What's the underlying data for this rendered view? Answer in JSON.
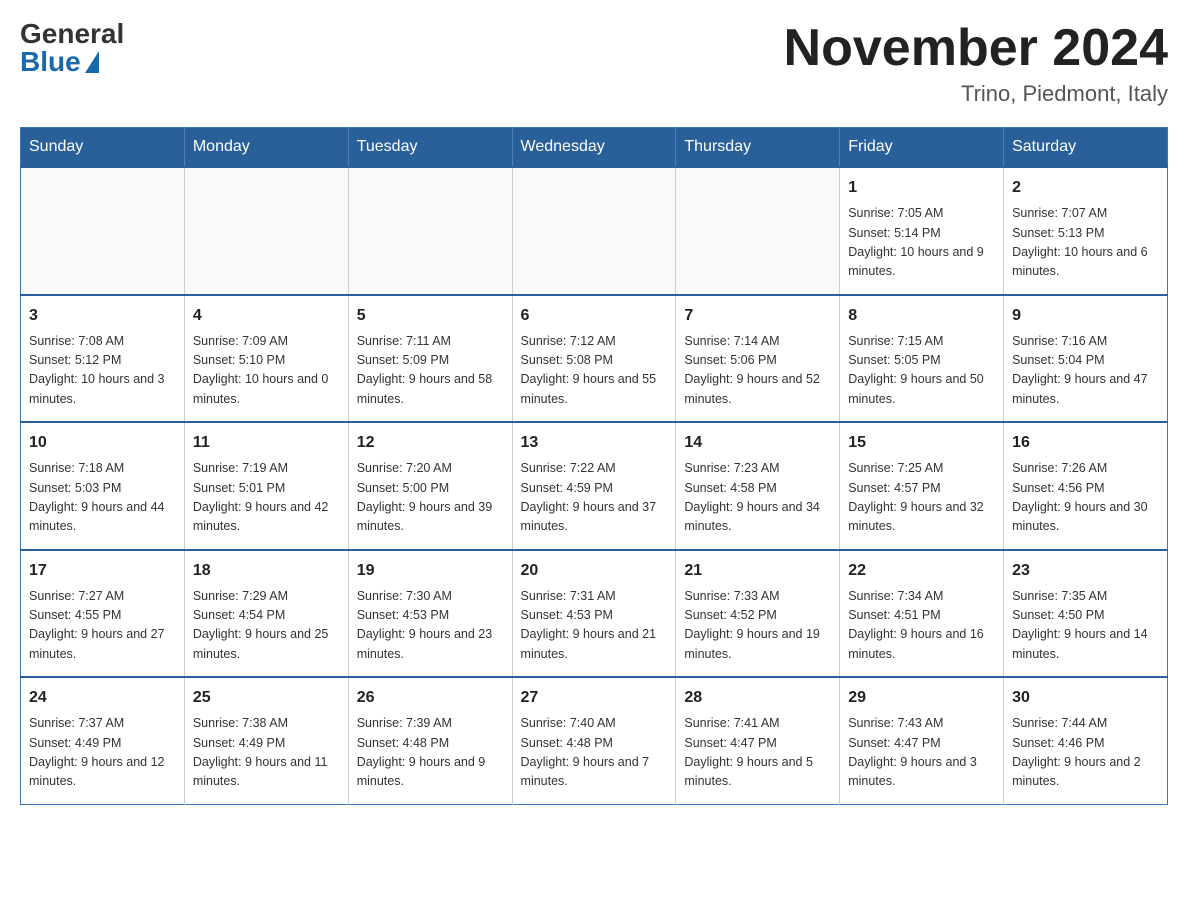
{
  "logo": {
    "general": "General",
    "blue": "Blue"
  },
  "title": "November 2024",
  "location": "Trino, Piedmont, Italy",
  "days_of_week": [
    "Sunday",
    "Monday",
    "Tuesday",
    "Wednesday",
    "Thursday",
    "Friday",
    "Saturday"
  ],
  "weeks": [
    [
      {
        "day": "",
        "info": ""
      },
      {
        "day": "",
        "info": ""
      },
      {
        "day": "",
        "info": ""
      },
      {
        "day": "",
        "info": ""
      },
      {
        "day": "",
        "info": ""
      },
      {
        "day": "1",
        "info": "Sunrise: 7:05 AM\nSunset: 5:14 PM\nDaylight: 10 hours and 9 minutes."
      },
      {
        "day": "2",
        "info": "Sunrise: 7:07 AM\nSunset: 5:13 PM\nDaylight: 10 hours and 6 minutes."
      }
    ],
    [
      {
        "day": "3",
        "info": "Sunrise: 7:08 AM\nSunset: 5:12 PM\nDaylight: 10 hours and 3 minutes."
      },
      {
        "day": "4",
        "info": "Sunrise: 7:09 AM\nSunset: 5:10 PM\nDaylight: 10 hours and 0 minutes."
      },
      {
        "day": "5",
        "info": "Sunrise: 7:11 AM\nSunset: 5:09 PM\nDaylight: 9 hours and 58 minutes."
      },
      {
        "day": "6",
        "info": "Sunrise: 7:12 AM\nSunset: 5:08 PM\nDaylight: 9 hours and 55 minutes."
      },
      {
        "day": "7",
        "info": "Sunrise: 7:14 AM\nSunset: 5:06 PM\nDaylight: 9 hours and 52 minutes."
      },
      {
        "day": "8",
        "info": "Sunrise: 7:15 AM\nSunset: 5:05 PM\nDaylight: 9 hours and 50 minutes."
      },
      {
        "day": "9",
        "info": "Sunrise: 7:16 AM\nSunset: 5:04 PM\nDaylight: 9 hours and 47 minutes."
      }
    ],
    [
      {
        "day": "10",
        "info": "Sunrise: 7:18 AM\nSunset: 5:03 PM\nDaylight: 9 hours and 44 minutes."
      },
      {
        "day": "11",
        "info": "Sunrise: 7:19 AM\nSunset: 5:01 PM\nDaylight: 9 hours and 42 minutes."
      },
      {
        "day": "12",
        "info": "Sunrise: 7:20 AM\nSunset: 5:00 PM\nDaylight: 9 hours and 39 minutes."
      },
      {
        "day": "13",
        "info": "Sunrise: 7:22 AM\nSunset: 4:59 PM\nDaylight: 9 hours and 37 minutes."
      },
      {
        "day": "14",
        "info": "Sunrise: 7:23 AM\nSunset: 4:58 PM\nDaylight: 9 hours and 34 minutes."
      },
      {
        "day": "15",
        "info": "Sunrise: 7:25 AM\nSunset: 4:57 PM\nDaylight: 9 hours and 32 minutes."
      },
      {
        "day": "16",
        "info": "Sunrise: 7:26 AM\nSunset: 4:56 PM\nDaylight: 9 hours and 30 minutes."
      }
    ],
    [
      {
        "day": "17",
        "info": "Sunrise: 7:27 AM\nSunset: 4:55 PM\nDaylight: 9 hours and 27 minutes."
      },
      {
        "day": "18",
        "info": "Sunrise: 7:29 AM\nSunset: 4:54 PM\nDaylight: 9 hours and 25 minutes."
      },
      {
        "day": "19",
        "info": "Sunrise: 7:30 AM\nSunset: 4:53 PM\nDaylight: 9 hours and 23 minutes."
      },
      {
        "day": "20",
        "info": "Sunrise: 7:31 AM\nSunset: 4:53 PM\nDaylight: 9 hours and 21 minutes."
      },
      {
        "day": "21",
        "info": "Sunrise: 7:33 AM\nSunset: 4:52 PM\nDaylight: 9 hours and 19 minutes."
      },
      {
        "day": "22",
        "info": "Sunrise: 7:34 AM\nSunset: 4:51 PM\nDaylight: 9 hours and 16 minutes."
      },
      {
        "day": "23",
        "info": "Sunrise: 7:35 AM\nSunset: 4:50 PM\nDaylight: 9 hours and 14 minutes."
      }
    ],
    [
      {
        "day": "24",
        "info": "Sunrise: 7:37 AM\nSunset: 4:49 PM\nDaylight: 9 hours and 12 minutes."
      },
      {
        "day": "25",
        "info": "Sunrise: 7:38 AM\nSunset: 4:49 PM\nDaylight: 9 hours and 11 minutes."
      },
      {
        "day": "26",
        "info": "Sunrise: 7:39 AM\nSunset: 4:48 PM\nDaylight: 9 hours and 9 minutes."
      },
      {
        "day": "27",
        "info": "Sunrise: 7:40 AM\nSunset: 4:48 PM\nDaylight: 9 hours and 7 minutes."
      },
      {
        "day": "28",
        "info": "Sunrise: 7:41 AM\nSunset: 4:47 PM\nDaylight: 9 hours and 5 minutes."
      },
      {
        "day": "29",
        "info": "Sunrise: 7:43 AM\nSunset: 4:47 PM\nDaylight: 9 hours and 3 minutes."
      },
      {
        "day": "30",
        "info": "Sunrise: 7:44 AM\nSunset: 4:46 PM\nDaylight: 9 hours and 2 minutes."
      }
    ]
  ]
}
